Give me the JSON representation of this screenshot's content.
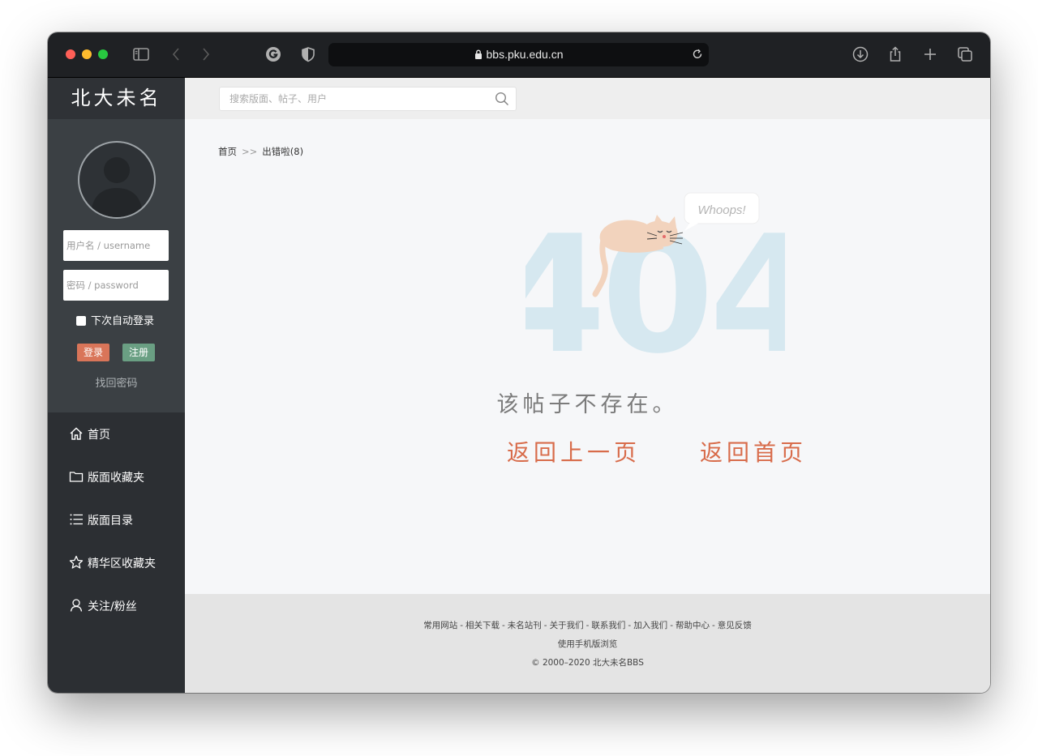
{
  "browser": {
    "url": "bbs.pku.edu.cn"
  },
  "sidebar": {
    "logo": "北大未名",
    "login": {
      "username_placeholder": "用户名 / username",
      "password_placeholder": "密码 / password",
      "remember": "下次自动登录",
      "login_label": "登录",
      "register_label": "注册",
      "forgot_label": "找回密码"
    },
    "nav": [
      {
        "label": "首页",
        "icon": "home-icon"
      },
      {
        "label": "版面收藏夹",
        "icon": "folder-icon"
      },
      {
        "label": "版面目录",
        "icon": "list-icon"
      },
      {
        "label": "精华区收藏夹",
        "icon": "star-icon"
      },
      {
        "label": "关注/粉丝",
        "icon": "person-icon"
      }
    ]
  },
  "search": {
    "placeholder": "搜索版面、帖子、用户"
  },
  "breadcrumb": {
    "home": "首页",
    "separator": ">>",
    "current": "出错啦(8)"
  },
  "error": {
    "code": "404",
    "bubble": "Whoops!",
    "message": "该帖子不存在。",
    "back_link": "返回上一页",
    "home_link": "返回首页"
  },
  "footer": {
    "links": [
      "常用网站",
      "相关下载",
      "未名站刊",
      "关于我们",
      "联系我们",
      "加入我们",
      "帮助中心",
      "意见反馈"
    ],
    "mobile": "使用手机版浏览",
    "copyright": "© 2000–2020 北大未名BBS"
  },
  "colors": {
    "accent": "#d86c4b",
    "login_button": "#d97559",
    "register_button": "#6a9f83",
    "sidebar": "#2c2f33",
    "code_digits": "#d6e8f0"
  }
}
